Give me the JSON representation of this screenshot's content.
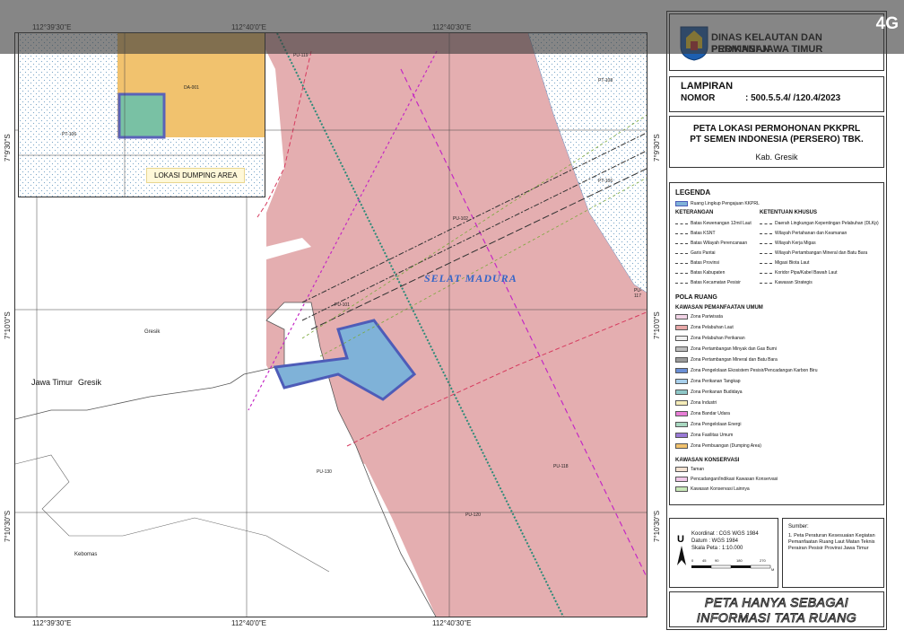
{
  "header": {
    "agency_line1": "DINAS KELAUTAN DAN PERIKANAN",
    "agency_line2": "PROVINSI JAWA TIMUR"
  },
  "network": "4G",
  "lampiran": {
    "title": "LAMPIRAN",
    "nomor_label": "NOMOR",
    "nomor_value": ": 500.5.5.4/         /120.4/2023"
  },
  "map_title": {
    "line1": "PETA LOKASI PERMOHONAN PKKPRL",
    "line2": "PT SEMEN INDONESIA (PERSERO) TBK.",
    "line3": "Kab. Gresik"
  },
  "legend": {
    "title": "LEGENDA",
    "first_item": "Ruang Lingkup Pengajuan KKPRL",
    "keterangan": "KETERANGAN",
    "ketentuan": "KETENTUAN KHUSUS",
    "lines_left": [
      "Batas Kewenangan 12mil Laut",
      "Batas KSNT",
      "Batas Wilayah Perencanaan",
      "Garis Pantai",
      "Batas Provinsi",
      "Batas Kabupaten",
      "Batas Kecamatan Pesisir"
    ],
    "lines_right": [
      "Daerah Lingkungan Kepentingan Pelabuhan (DLKp)",
      "Wilayah Pertahanan dan Keamanan",
      "Wilayah Kerja Migas",
      "Wilayah Pertambangan Mineral dan Batu Bara",
      "Migasi Biota Laut",
      "Koridor Pipa/Kabel Bawah Laut",
      "Kawasan Strategis"
    ],
    "pola_ruang": "POLA RUANG",
    "kawasan_umum": "KAWASAN PEMANFAATAN UMUM",
    "zones": [
      "Zona Pariwisata",
      "Zona Pelabuhan Laut",
      "Zona Pelabuhan Perikanan",
      "Zona Pertambangan Minyak dan Gas Bumi",
      "Zona Pertambangan Mineral dan Batu Bara",
      "Zona Pengelolaan Ekosistem Pesisir/Pencadangan Karbon Biru",
      "Zona Perikanan Tangkap",
      "Zona Perikanan Budidaya",
      "Zona Industri",
      "Zona Bandar Udara",
      "Zona Pengelolaan Energi",
      "Zona Fasilitas Umum",
      "Zona Pembuangan (Dumping Area)"
    ],
    "zone_colors": [
      "#f2d4e6",
      "#e8a8a8",
      "#f0f0f0",
      "#bdbdbd",
      "#9a9a9a",
      "#6a8fd6",
      "#a8d0ec",
      "#8ec8c8",
      "#f5ecb8",
      "#e87ed6",
      "#a8d8c0",
      "#9a7ad6",
      "#f1c26e"
    ],
    "kawasan_konservasi": "KAWASAN KONSERVASI",
    "konservasi": [
      "Taman",
      "Pencadangan/Indikasi Kawasan Konservasi",
      "Kawasan Konservasi Lainnya"
    ],
    "konservasi_colors": [
      "#f3e2d2",
      "#f0c8e8",
      "#c8e8b8"
    ]
  },
  "map_info": {
    "koordinat": "Koordinat    : CGS WGS 1984",
    "datum": "Datum        : WGS 1984",
    "skala": "Skala Peta  : 1:10.000",
    "scale_ticks": [
      "0",
      "45",
      "90",
      "180",
      "270"
    ],
    "scale_unit": "M"
  },
  "sumber": {
    "title": "Sumber:",
    "text": "1. Peta Peraturan Kesesuaian Kegiatan Pemanfaatan Ruang Laut Matan Teknis Perairan Pesisir Provinsi Jawa Timur"
  },
  "disclaimer": {
    "line1": "PETA HANYA SEBAGAI",
    "line2": "INFORMASI TATA RUANG"
  },
  "coords": {
    "top": [
      "112°39'30\"E",
      "112°40'0\"E",
      "112°40'30\"E"
    ],
    "bottom": [
      "112°39'30\"E",
      "112°40'0\"E",
      "112°40'30\"E"
    ],
    "left": [
      "7°9'30\"S",
      "7°10'0\"S",
      "7°10'30\"S"
    ],
    "right": [
      "7°9'30\"S",
      "7°10'0\"S",
      "7°10'30\"S"
    ]
  },
  "map_labels": {
    "sea": "SELAT MADURA",
    "jawa_timur": "Jawa Timur",
    "gresik_big": "Gresik",
    "gresik_small": "Gresik",
    "kebomas": "Kebomas",
    "inset_dumping": "LOKASI DUMPING AREA",
    "zone_codes": [
      "PU-118",
      "PU-120",
      "PU-101",
      "PU-130",
      "PU-119",
      "PU-117",
      "PT-108",
      "PT-106",
      "PU-102",
      "PT-106",
      "DA-001"
    ]
  }
}
